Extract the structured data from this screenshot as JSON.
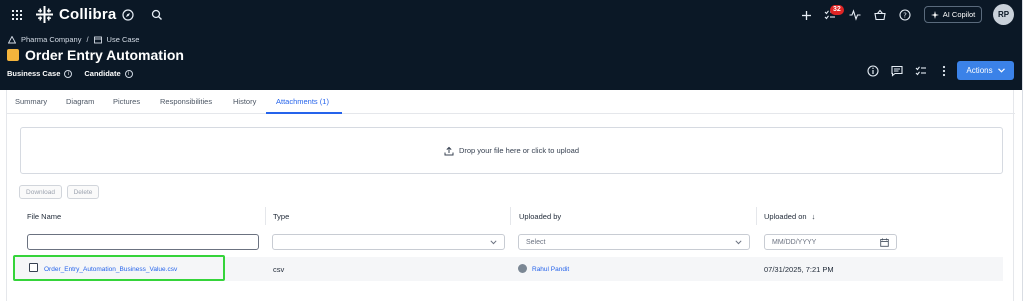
{
  "app": {
    "brand": "Collibra",
    "notifications_count": "32",
    "copilot_label": "AI Copilot",
    "user_initials": "RP"
  },
  "breadcrumb": {
    "community": "Pharma Company",
    "separator": "/",
    "domain": "Use Case"
  },
  "asset": {
    "title": "Order Entry Automation",
    "type": "Business Case",
    "status": "Candidate",
    "actions_label": "Actions"
  },
  "tabs": [
    {
      "label": "Summary"
    },
    {
      "label": "Diagram"
    },
    {
      "label": "Pictures"
    },
    {
      "label": "Responsibilities"
    },
    {
      "label": "History"
    },
    {
      "label": "Attachments (1)"
    }
  ],
  "upload": {
    "dropzone_text": "Drop your file here or click to upload",
    "download_label": "Download",
    "delete_label": "Delete"
  },
  "table": {
    "columns": [
      "File Name",
      "Type",
      "Uploaded by",
      "Uploaded on"
    ],
    "sort_indicator": "↓",
    "filters": {
      "file_name_value": "",
      "type_value": "",
      "uploaded_by_placeholder": "Select",
      "uploaded_on_placeholder": "MM/DD/YYYY"
    },
    "rows": [
      {
        "file_name": "Order_Entry_Automation_Business_Value.csv",
        "type": "csv",
        "uploaded_by": "Rahul Pandit",
        "uploaded_on": "07/31/2025, 7:21 PM"
      }
    ]
  },
  "colors": {
    "header_bg": "#0b1826",
    "accent": "#3b82e8",
    "link": "#2563eb",
    "asset_icon": "#f4b43c",
    "badge": "#e02424",
    "highlight": "#35d43a"
  }
}
